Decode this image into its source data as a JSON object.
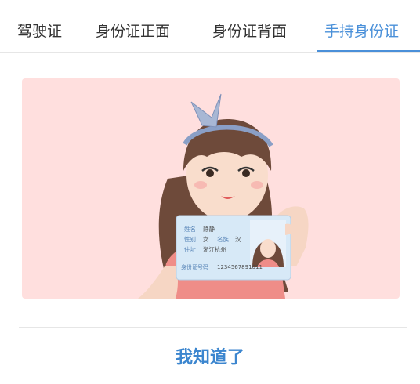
{
  "tabs": [
    {
      "label": "驾驶证",
      "active": false
    },
    {
      "label": "身份证正面",
      "active": false
    },
    {
      "label": "身份证背面",
      "active": false
    },
    {
      "label": "手持身份证",
      "active": true
    }
  ],
  "id_card": {
    "name_label": "姓名",
    "name_value": "静静",
    "gender_label": "性别",
    "gender_value": "女",
    "ethnicity_label": "名族",
    "ethnicity_value": "汉",
    "address_label": "住址",
    "address_value": "浙江杭州",
    "id_number_label": "身份证号码",
    "id_number_value": "1234567891011"
  },
  "confirm_label": "我知道了",
  "colors": {
    "accent": "#4a90d9",
    "button_text": "#3c86cf",
    "illustration_bg": "#ffdfde"
  }
}
